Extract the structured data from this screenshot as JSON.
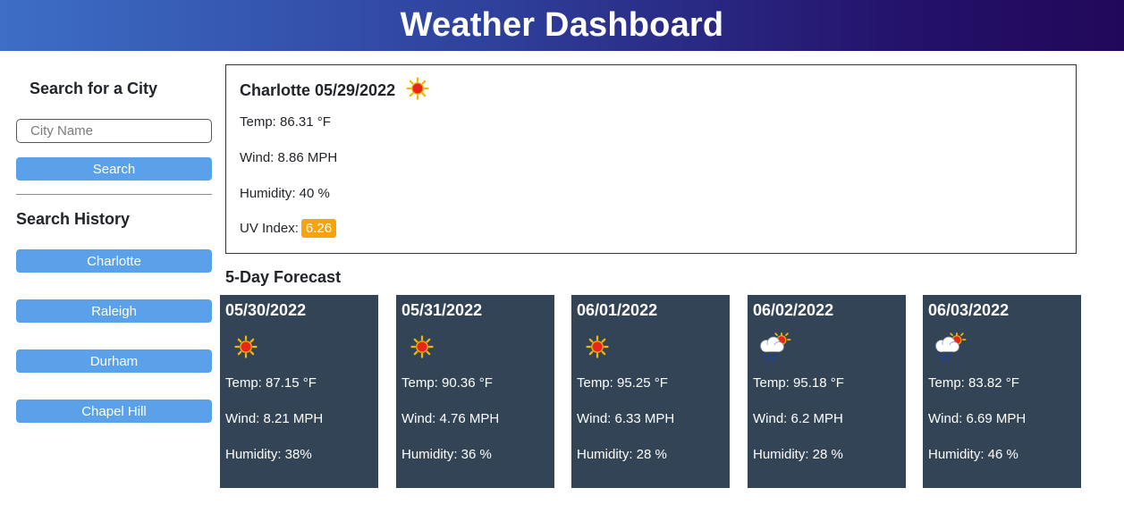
{
  "header": {
    "title": "Weather Dashboard"
  },
  "sidebar": {
    "search_title": "Search for a City",
    "city_placeholder": "City Name",
    "city_value": "",
    "search_button": "Search",
    "history_title": "Search History",
    "history": [
      {
        "label": "Charlotte"
      },
      {
        "label": "Raleigh"
      },
      {
        "label": "Durham"
      },
      {
        "label": "Chapel Hill"
      }
    ]
  },
  "current": {
    "title": "Charlotte 05/29/2022",
    "icon": "sunny-icon",
    "temp": "Temp: 86.31 °F",
    "wind": "Wind: 8.86 MPH",
    "humidity": "Humidity: 40 %",
    "uv_label": "UV Index:",
    "uv_value": "6.26",
    "uv_color": "#f5a30f"
  },
  "forecast": {
    "title": "5-Day Forecast",
    "card_color": "#334456",
    "days": [
      {
        "date": "05/30/2022",
        "icon": "sunny-icon",
        "temp": "Temp: 87.15 °F",
        "wind": "Wind: 8.21 MPH",
        "humidity": "Humidity: 38%"
      },
      {
        "date": "05/31/2022",
        "icon": "sunny-icon",
        "temp": "Temp: 90.36 °F",
        "wind": "Wind: 4.76 MPH",
        "humidity": "Humidity: 36 %"
      },
      {
        "date": "06/01/2022",
        "icon": "sunny-icon",
        "temp": "Temp: 95.25 °F",
        "wind": "Wind: 6.33 MPH",
        "humidity": "Humidity: 28 %"
      },
      {
        "date": "06/02/2022",
        "icon": "rain-sun-icon",
        "temp": "Temp: 95.18 °F",
        "wind": "Wind: 6.2 MPH",
        "humidity": "Humidity: 28 %"
      },
      {
        "date": "06/03/2022",
        "icon": "rain-sun-icon",
        "temp": "Temp: 83.82 °F",
        "wind": "Wind: 6.69 MPH",
        "humidity": "Humidity: 46 %"
      }
    ]
  }
}
